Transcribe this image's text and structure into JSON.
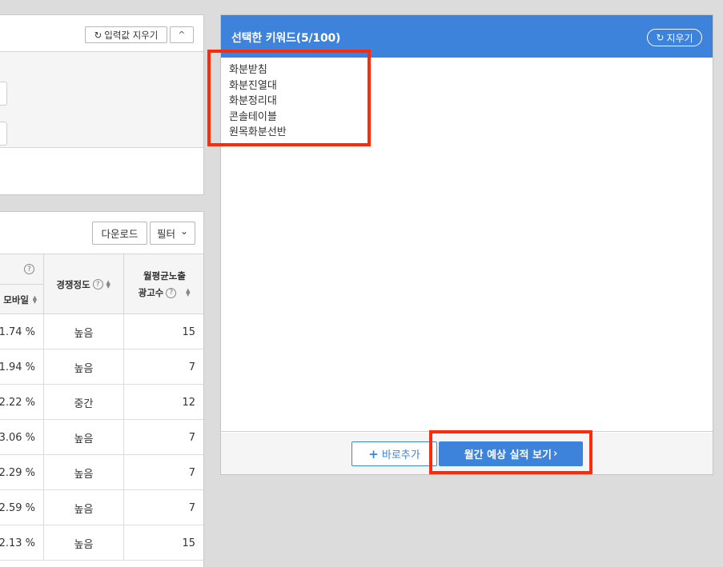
{
  "input_panel": {
    "reset_label": "입력값 지우기",
    "collapse_icon": "^"
  },
  "table_panel": {
    "download_label": "다운로드",
    "filter_label": "필터",
    "columns": {
      "col1_sub": "모바일",
      "col2": "경쟁정도",
      "col3_line1": "월평균노출",
      "col3_line2": "광고수"
    },
    "rows": [
      {
        "ctr": "1.74 %",
        "competition": "높음",
        "ads": "15"
      },
      {
        "ctr": "1.94 %",
        "competition": "높음",
        "ads": "7"
      },
      {
        "ctr": "2.22 %",
        "competition": "중간",
        "ads": "12"
      },
      {
        "ctr": "3.06 %",
        "competition": "높음",
        "ads": "7"
      },
      {
        "ctr": "2.29 %",
        "competition": "높음",
        "ads": "7"
      },
      {
        "ctr": "2.59 %",
        "competition": "높음",
        "ads": "7"
      },
      {
        "ctr": "2.13 %",
        "competition": "높음",
        "ads": "15"
      }
    ]
  },
  "selected_panel": {
    "title": "선택한 키워드(5/100)",
    "clear_label": "지우기",
    "keywords": [
      "화분받침",
      "화분진열대",
      "화분정리대",
      "콘솔테이블",
      "원목화분선반"
    ],
    "add_label": "바로추가",
    "view_label": "월간 예상 실적 보기"
  },
  "icons": {
    "refresh": "↻",
    "question": "?",
    "chevron_down": "⌄",
    "chevron_right": "›",
    "plus": "+"
  },
  "colors": {
    "primary": "#3d82db",
    "highlight": "#ff2a0a"
  }
}
